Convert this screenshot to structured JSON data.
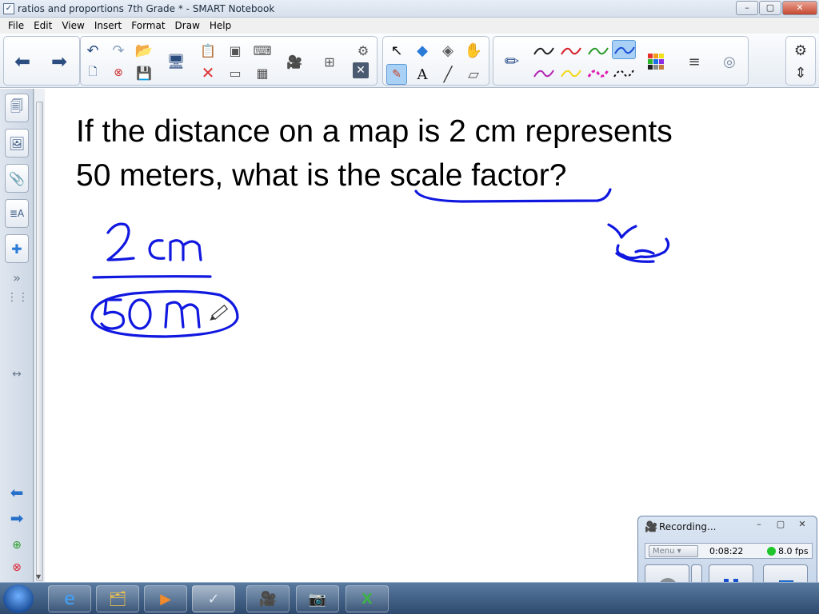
{
  "window": {
    "title": "ratios and proportions 7th Grade * - SMART Notebook",
    "min_label": "–",
    "max_label": "▢",
    "close_label": "✕"
  },
  "menu": {
    "items": [
      "File",
      "Edit",
      "View",
      "Insert",
      "Format",
      "Draw",
      "Help"
    ]
  },
  "canvas": {
    "question_line1": "If the distance on a map is 2 cm represents",
    "question_line2_prefix": "50 meters, what is the ",
    "question_line2_highlight": "scale factor",
    "question_line2_suffix": "?",
    "handwriting": {
      "numerator": "2cm",
      "denominator": "50 m",
      "ink_color": "#1018e0"
    }
  },
  "recorder": {
    "title": "Recording...",
    "menu_label": "Menu",
    "elapsed": "0:08:22",
    "fps": "8.0 fps",
    "status_color": "#1fc62b"
  },
  "icons": {
    "toolbar": [
      "back-arrow-icon",
      "forward-arrow-icon",
      "undo-icon",
      "redo-icon",
      "new-page-icon",
      "delete-page-icon",
      "open-icon",
      "save-icon",
      "screen-icon",
      "paste-icon",
      "delete-icon",
      "screen-shade-icon",
      "capture-icon",
      "keyboard-icon",
      "table-icon",
      "recorder-icon",
      "fullscreen-icon",
      "close-icon",
      "select-icon",
      "shapes-icon",
      "eraser-icon",
      "magic-pen-icon",
      "creative-pen-icon",
      "text-icon",
      "line-icon",
      "fill-icon",
      "pen-icon",
      "color-palette-icon",
      "line-style-icon",
      "transparency-icon",
      "gear-icon",
      "move-toolbar-icon"
    ],
    "sidebar": [
      "page-sorter-icon",
      "gallery-icon",
      "attachments-icon",
      "properties-icon",
      "addons-icon"
    ]
  }
}
